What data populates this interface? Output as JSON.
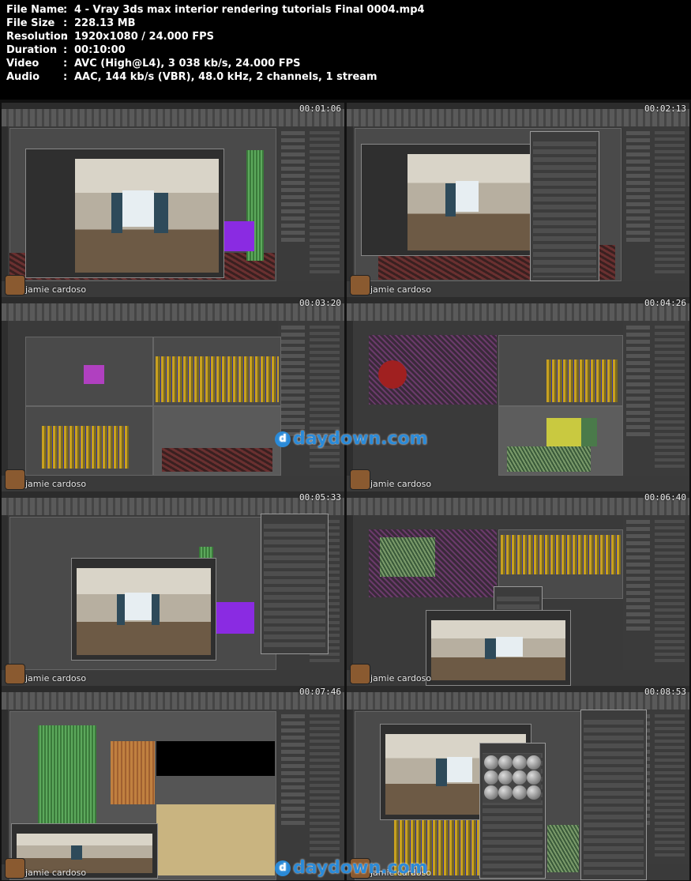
{
  "media_info": [
    {
      "key": "File Name",
      "value": "4 - Vray 3ds max interior rendering tutorials Final 0004.mp4"
    },
    {
      "key": "File Size",
      "value": "228.13 MB"
    },
    {
      "key": "Resolution",
      "value": "1920x1080 / 24.000 FPS"
    },
    {
      "key": "Duration",
      "value": "00:10:00"
    },
    {
      "key": "Video",
      "value": "AVC (High@L4), 3 038 kb/s, 24.000 FPS"
    },
    {
      "key": "Audio",
      "value": "AAC, 144 kb/s (VBR), 48.0 kHz, 2 channels, 1 stream"
    }
  ],
  "separator": ":",
  "thumbnails": [
    {
      "timestamp": "00:01:06",
      "username": "jamie cardoso"
    },
    {
      "timestamp": "00:02:13",
      "username": "jamie cardoso"
    },
    {
      "timestamp": "00:03:20",
      "username": "jamie cardoso"
    },
    {
      "timestamp": "00:04:26",
      "username": "jamie cardoso"
    },
    {
      "timestamp": "00:05:33",
      "username": "jamie cardoso"
    },
    {
      "timestamp": "00:06:40",
      "username": "jamie cardoso"
    },
    {
      "timestamp": "00:07:46",
      "username": "jamie cardoso"
    },
    {
      "timestamp": "00:08:53",
      "username": "jamie cardoso"
    }
  ],
  "watermark": "daydown.com",
  "watermark_icon": "d",
  "colors": {
    "watermark": "#2a8ad8",
    "header_bg": "#000000",
    "header_text": "#ffffff"
  }
}
